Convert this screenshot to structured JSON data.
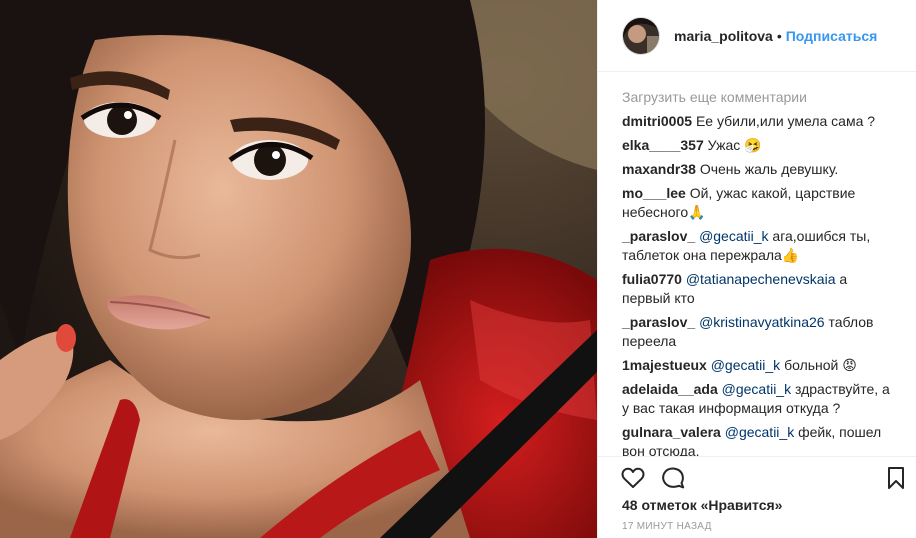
{
  "post": {
    "username": "maria_politova",
    "separator": "•",
    "follow_label": "Подписаться"
  },
  "comments": {
    "load_more": "Загрузить еще комментарии",
    "items": [
      {
        "user": "dmitri0005",
        "mention": "",
        "text": "Ее убили,или умела сама ?"
      },
      {
        "user": "elka____357",
        "mention": "",
        "text": "Ужас 🤧"
      },
      {
        "user": "maxandr38",
        "mention": "",
        "text": "Очень жаль девушку."
      },
      {
        "user": "mo___lee",
        "mention": "",
        "text": "Ой, ужас какой, царствие небесного🙏"
      },
      {
        "user": "_paraslov_",
        "mention": "@gecatii_k",
        "text": "ага,ошибся ты, таблеток она пережрала👍"
      },
      {
        "user": "fulia0770",
        "mention": "@tatianapechenevskaia",
        "text": "а первый кто"
      },
      {
        "user": "_paraslov_",
        "mention": "@kristinavyatkina26",
        "text": "таблов переела"
      },
      {
        "user": "1majestueux",
        "mention": "@gecatii_k",
        "text": "больной 😡"
      },
      {
        "user": "adelaida__ada",
        "mention": "@gecatii_k",
        "text": "здраствуйте, а у вас такая информация откуда ?"
      },
      {
        "user": "gulnara_valera",
        "mention": "@gecatii_k",
        "text": "фейк, пошел вон отсюда."
      }
    ]
  },
  "actions": {
    "like_icon": "heart-icon",
    "comment_icon": "comment-icon",
    "save_icon": "bookmark-icon"
  },
  "likes_text": "48 отметок «Нравится»",
  "time_text": "17 МИНУТ НАЗАД",
  "colors": {
    "link": "#3897f0",
    "mention": "#003569",
    "muted": "#999999",
    "text": "#262626",
    "border": "#efefef"
  }
}
